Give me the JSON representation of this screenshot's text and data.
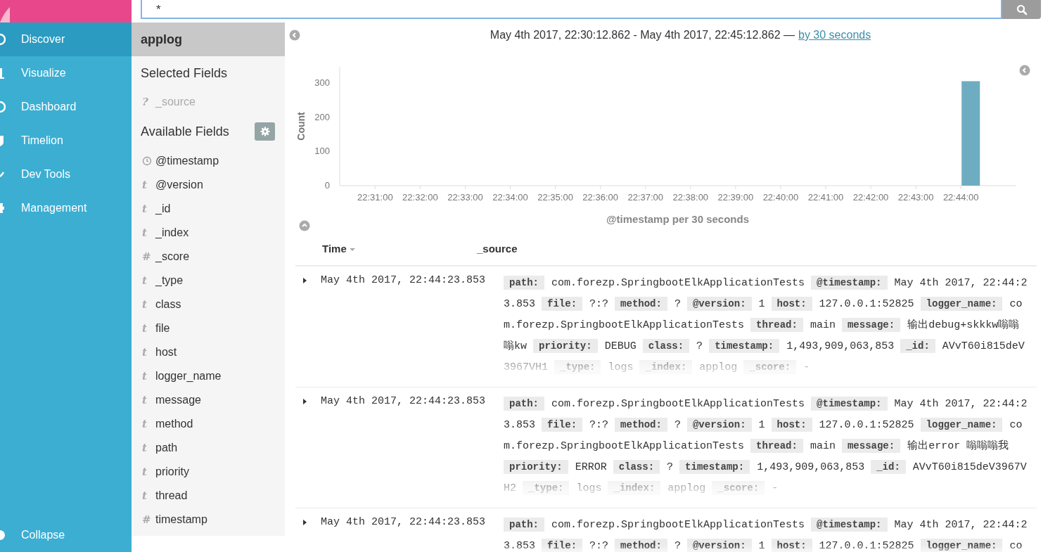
{
  "nav": {
    "items": [
      {
        "label": "Discover",
        "selected": true
      },
      {
        "label": "Visualize",
        "selected": false
      },
      {
        "label": "Dashboard",
        "selected": false
      },
      {
        "label": "Timelion",
        "selected": false
      },
      {
        "label": "Dev Tools",
        "selected": false
      },
      {
        "label": "Management",
        "selected": false
      }
    ],
    "collapse": "Collapse"
  },
  "search": {
    "value": "*"
  },
  "field_sidebar": {
    "index_pattern": "applog",
    "selected_heading": "Selected Fields",
    "selected_fields": [
      {
        "kind": "unknown",
        "glyph": "?",
        "name": "_source"
      }
    ],
    "available_heading": "Available Fields",
    "available_fields": [
      {
        "kind": "date",
        "name": "@timestamp"
      },
      {
        "kind": "string",
        "glyph": "t",
        "name": "@version"
      },
      {
        "kind": "string",
        "glyph": "t",
        "name": "_id"
      },
      {
        "kind": "string",
        "glyph": "t",
        "name": "_index"
      },
      {
        "kind": "number",
        "glyph": "#",
        "name": "_score"
      },
      {
        "kind": "string",
        "glyph": "t",
        "name": "_type"
      },
      {
        "kind": "string",
        "glyph": "t",
        "name": "class"
      },
      {
        "kind": "string",
        "glyph": "t",
        "name": "file"
      },
      {
        "kind": "string",
        "glyph": "t",
        "name": "host"
      },
      {
        "kind": "string",
        "glyph": "t",
        "name": "logger_name"
      },
      {
        "kind": "string",
        "glyph": "t",
        "name": "message"
      },
      {
        "kind": "string",
        "glyph": "t",
        "name": "method"
      },
      {
        "kind": "string",
        "glyph": "t",
        "name": "path"
      },
      {
        "kind": "string",
        "glyph": "t",
        "name": "priority"
      },
      {
        "kind": "string",
        "glyph": "t",
        "name": "thread"
      },
      {
        "kind": "number",
        "glyph": "#",
        "name": "timestamp"
      }
    ]
  },
  "histogram": {
    "range": "May 4th 2017, 22:30:12.862 - May 4th 2017, 22:45:12.862 —",
    "interval_link": "by 30 seconds",
    "chart_data": {
      "type": "bar",
      "xlabel": "@timestamp per 30 seconds",
      "ylabel": "Count",
      "categories": [
        null,
        null,
        "22:31:00",
        null,
        "22:32:00",
        null,
        "22:33:00",
        null,
        "22:34:00",
        null,
        "22:35:00",
        null,
        "22:36:00",
        null,
        "22:37:00",
        null,
        "22:38:00",
        null,
        "22:39:00",
        null,
        "22:40:00",
        null,
        "22:41:00",
        null,
        "22:42:00",
        null,
        "22:43:00",
        null,
        "22:44:00",
        null,
        null
      ],
      "series": [
        {
          "color": "#6eadc1",
          "values": [
            0,
            0,
            0,
            0,
            0,
            0,
            0,
            0,
            0,
            0,
            0,
            0,
            0,
            0,
            0,
            0,
            0,
            0,
            0,
            0,
            0,
            0,
            0,
            0,
            0,
            0,
            0,
            0,
            305,
            0,
            0
          ]
        }
      ],
      "ylim": [
        0,
        347
      ],
      "yticks": [
        0,
        100,
        200,
        300
      ]
    }
  },
  "table": {
    "columns": [
      "Time",
      "_source"
    ],
    "rows": [
      {
        "time": "May 4th 2017, 22:44:23.853",
        "fields": [
          {
            "key": "path:",
            "value": "com.forezp.SpringbootElkApplicationTests"
          },
          {
            "key": "@timestamp:",
            "value": "May 4th 2017, 22:44:23.853"
          },
          {
            "key": "file:",
            "value": "?:?"
          },
          {
            "key": "method:",
            "value": "?"
          },
          {
            "key": "@version:",
            "value": "1"
          },
          {
            "key": "host:",
            "value": "127.0.0.1:52825"
          },
          {
            "key": "logger_name:",
            "value": "com.forezp.SpringbootElkApplicationTests"
          },
          {
            "key": "thread:",
            "value": "main"
          },
          {
            "key": "message:",
            "value": "输出debug+skkkw嗡嗡嗡kw"
          },
          {
            "key": "priority:",
            "value": "DEBUG"
          },
          {
            "key": "class:",
            "value": "?"
          },
          {
            "key": "timestamp:",
            "value": "1,493,909,063,853"
          },
          {
            "key": "_id:",
            "value": "AVvT60i815deV3967VH1"
          },
          {
            "key": "_type:",
            "value": "logs"
          },
          {
            "key": "_index:",
            "value": "applog"
          },
          {
            "key": "_score:",
            "value": "-"
          }
        ]
      },
      {
        "time": "May 4th 2017, 22:44:23.853",
        "fields": [
          {
            "key": "path:",
            "value": "com.forezp.SpringbootElkApplicationTests"
          },
          {
            "key": "@timestamp:",
            "value": "May 4th 2017, 22:44:23.853"
          },
          {
            "key": "file:",
            "value": "?:?"
          },
          {
            "key": "method:",
            "value": "?"
          },
          {
            "key": "@version:",
            "value": "1"
          },
          {
            "key": "host:",
            "value": "127.0.0.1:52825"
          },
          {
            "key": "logger_name:",
            "value": "com.forezp.SpringbootElkApplicationTests"
          },
          {
            "key": "thread:",
            "value": "main"
          },
          {
            "key": "message:",
            "value": "输出error 嗡嗡嗡我"
          },
          {
            "key": "priority:",
            "value": "ERROR"
          },
          {
            "key": "class:",
            "value": "?"
          },
          {
            "key": "timestamp:",
            "value": "1,493,909,063,853"
          },
          {
            "key": "_id:",
            "value": "AVvT60i815deV3967VH2"
          },
          {
            "key": "_type:",
            "value": "logs"
          },
          {
            "key": "_index:",
            "value": "applog"
          },
          {
            "key": "_score:",
            "value": "-"
          }
        ]
      },
      {
        "time": "May 4th 2017, 22:44:23.853",
        "fields": [
          {
            "key": "path:",
            "value": "com.forezp.SpringbootElkApplicationTests"
          },
          {
            "key": "@timestamp:",
            "value": "May 4th 2017, 22:44:23.853"
          },
          {
            "key": "file:",
            "value": "?:?"
          },
          {
            "key": "method:",
            "value": "?"
          },
          {
            "key": "@version:",
            "value": "1"
          },
          {
            "key": "host:",
            "value": "127.0.0.1:52825"
          },
          {
            "key": "logger_name:",
            "value": "co"
          }
        ]
      }
    ]
  }
}
